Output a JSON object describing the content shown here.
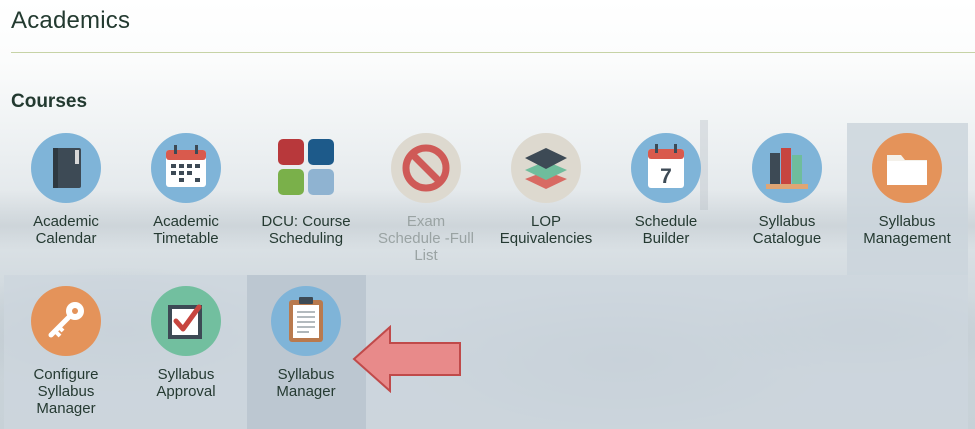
{
  "page": {
    "title": "Academics"
  },
  "section": {
    "title": "Courses"
  },
  "row1": [
    {
      "label": "Academic\nCalendar",
      "icon": "calendar-book-icon",
      "disabled": false
    },
    {
      "label": "Academic\nTimetable",
      "icon": "timetable-icon",
      "disabled": false
    },
    {
      "label": "DCU: Course\nScheduling",
      "icon": "color-grid-icon",
      "disabled": false
    },
    {
      "label": "Exam\nSchedule -Full\nList",
      "icon": "prohibited-icon",
      "disabled": true
    },
    {
      "label": "LOP\nEquivalencies",
      "icon": "layers-icon",
      "disabled": false
    },
    {
      "label": "Schedule\nBuilder",
      "icon": "calendar-7-icon",
      "disabled": false
    },
    {
      "label": "Syllabus\nCatalogue",
      "icon": "books-icon",
      "disabled": false
    },
    {
      "label": "Syllabus\nManagement",
      "icon": "folder-icon",
      "disabled": false
    }
  ],
  "row2": [
    {
      "label": "Configure\nSyllabus\nManager",
      "icon": "key-icon"
    },
    {
      "label": "Syllabus\nApproval",
      "icon": "checkbox-icon"
    },
    {
      "label": "Syllabus\nManager",
      "icon": "clipboard-icon"
    }
  ],
  "colors": {
    "blue": "#6ea3c9",
    "orange": "#e4935a",
    "green": "#6fbd9c",
    "beige": "#e0dcd0",
    "arrow": "#e88a8a"
  },
  "icon_colors": {
    "calendar": "#7fb4d8",
    "timetable": "#7fb4d8",
    "prohibited": "#ddd9cf",
    "layers": "#ddd9cf",
    "schedule": "#7fb4d8",
    "catalogue": "#7fb4d8",
    "folder": "#e4935a",
    "key": "#e4935a",
    "approval": "#72bf9f",
    "clipboard": "#7fb4d8"
  }
}
